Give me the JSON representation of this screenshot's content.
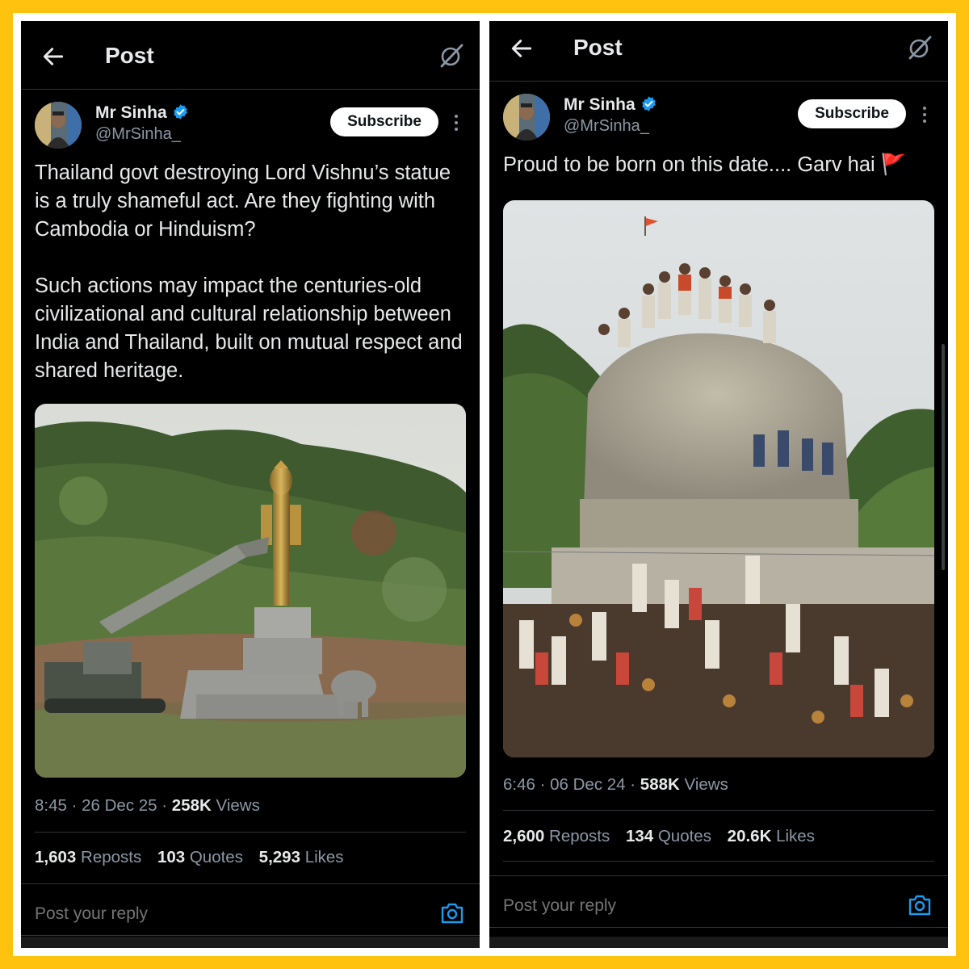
{
  "left_post": {
    "header": {
      "title": "Post"
    },
    "author": {
      "name": "Mr Sinha",
      "handle": "@MrSinha_"
    },
    "subscribe_label": "Subscribe",
    "text": "Thailand govt destroying Lord Vishnu’s statue is a truly shameful act. Are they fighting with Cambodia or Hinduism?\n\nSuch actions may impact the centuries-old civilizational and cultural relationship between India and Thailand, built on mutual respect and shared heritage.",
    "time": "8:45",
    "date": "26 Dec 25",
    "views_count": "258K",
    "views_label": "Views",
    "stats": {
      "reposts_count": "1,603",
      "reposts_label": "Reposts",
      "quotes_count": "103",
      "quotes_label": "Quotes",
      "likes_count": "5,293",
      "likes_label": "Likes"
    },
    "reply_placeholder": "Post your reply"
  },
  "right_post": {
    "header": {
      "title": "Post"
    },
    "author": {
      "name": "Mr Sinha",
      "handle": "@MrSinha_"
    },
    "subscribe_label": "Subscribe",
    "text": "Proud to be born on this date.... Garv hai",
    "emoji": "🚩",
    "time": "6:46",
    "date": "06 Dec 24",
    "views_count": "588K",
    "views_label": "Views",
    "stats": {
      "reposts_count": "2,600",
      "reposts_label": "Reposts",
      "quotes_count": "134",
      "quotes_label": "Quotes",
      "likes_count": "20.6K",
      "likes_label": "Likes"
    },
    "reply_placeholder": "Post your reply"
  },
  "colors": {
    "frame": "#FFC20E",
    "background": "#000000",
    "text_primary": "#E7E9EA",
    "text_secondary": "#8B98A5",
    "verified": "#1D9BF0",
    "divider": "#2F3336"
  },
  "icons": [
    "back-arrow-icon",
    "grok-icon",
    "verified-badge-icon",
    "more-options-icon",
    "camera-icon",
    "flag-emoji"
  ]
}
